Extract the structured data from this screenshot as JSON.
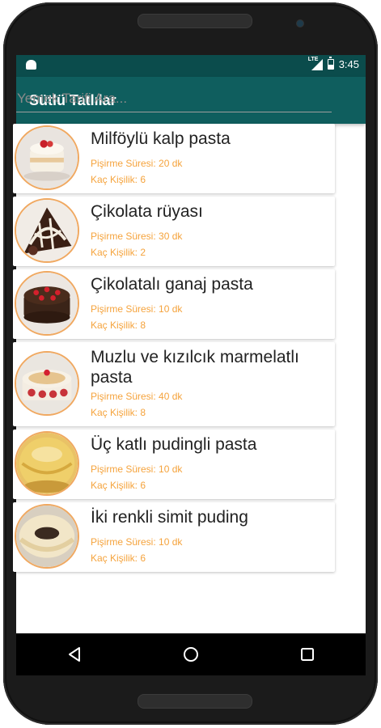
{
  "status_bar": {
    "time": "3:45",
    "network": "LTE"
  },
  "app_bar": {
    "title": "Sütlü Tatlılar"
  },
  "search": {
    "placeholder": "Yemek Tarifi Ara..."
  },
  "recipes": [
    {
      "name": "Milföylü kalp pasta",
      "time": "Pişirme Süresi: 20 dk",
      "servings": "Kaç Kişilik: 6"
    },
    {
      "name": "Çikolata rüyası",
      "time": "Pişirme Süresi: 30 dk",
      "servings": "Kaç Kişilik: 2"
    },
    {
      "name": "Çikolatalı ganaj pasta",
      "time": "Pişirme Süresi: 10 dk",
      "servings": "Kaç Kişilik: 8"
    },
    {
      "name": "Muzlu ve kızılcık marmelatlı pasta",
      "time": "Pişirme Süresi: 40 dk",
      "servings": "Kaç Kişilik: 8"
    },
    {
      "name": "Üç katlı pudingli pasta",
      "time": "Pişirme Süresi: 10 dk",
      "servings": "Kaç Kişilik: 6"
    },
    {
      "name": "İki renkli simit puding",
      "time": "Pişirme Süresi: 10 dk",
      "servings": "Kaç Kişilik: 6"
    }
  ],
  "nav": {
    "back": "back-icon",
    "home": "home-icon",
    "recents": "recents-icon"
  },
  "colors": {
    "status_bar": "#0b4c4c",
    "app_bar": "#0f5e5e",
    "accent": "#f5a33c",
    "thumb_border": "#f0a860"
  }
}
